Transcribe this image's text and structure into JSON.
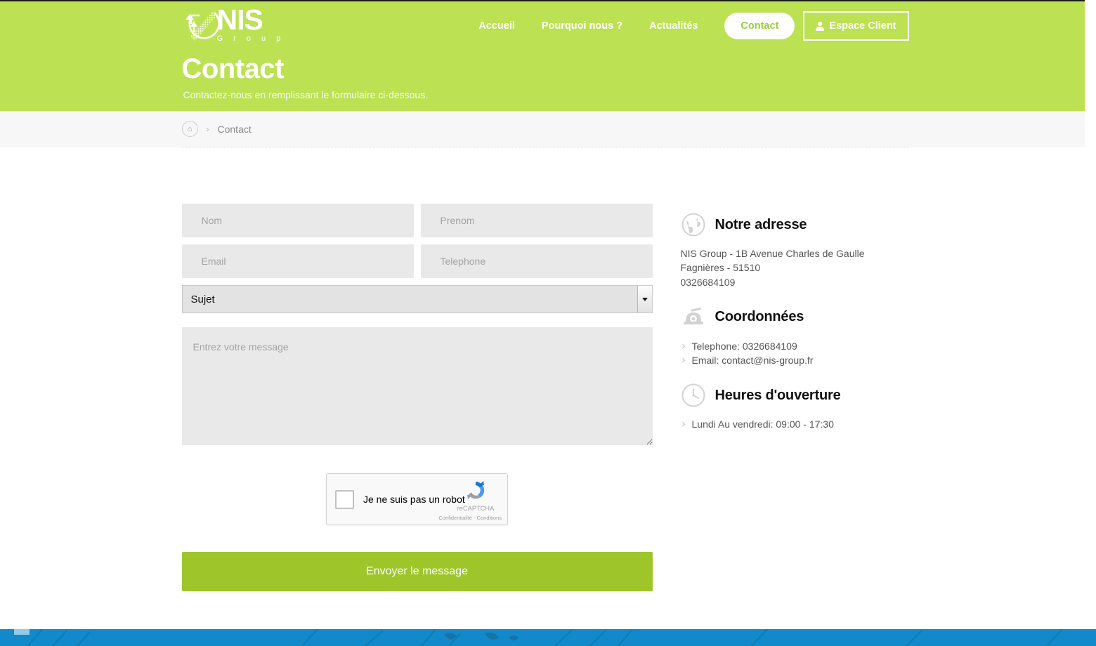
{
  "brand": {
    "name": "NIS",
    "tagline": "G r o u p",
    "logo_icon": "nis-swoosh-logo"
  },
  "nav": {
    "links": [
      {
        "label": "Accueil",
        "icon": null
      },
      {
        "label": "Pourquoi nous ?",
        "icon": null
      },
      {
        "label": "Actualités",
        "icon": null
      }
    ],
    "pill": {
      "label": "Contact"
    },
    "client": {
      "label": "Espace Client",
      "icon": "user-icon"
    }
  },
  "hero": {
    "title": "Contact",
    "subtitle": "Contactez-nous en remplissant le formulaire ci-dessous."
  },
  "breadcrumb": {
    "home_icon": "home-icon",
    "separator": "›",
    "current": "Contact"
  },
  "form": {
    "nom": {
      "placeholder": "Nom",
      "value": ""
    },
    "prenom": {
      "placeholder": "Prenom",
      "value": ""
    },
    "email": {
      "placeholder": "Email",
      "value": ""
    },
    "telephone": {
      "placeholder": "Telephone",
      "value": ""
    },
    "sujet": {
      "selected": "Sujet",
      "options": [
        "Sujet"
      ]
    },
    "message": {
      "placeholder": "Entrez votre message",
      "value": ""
    },
    "submit_label": "Envoyer le message"
  },
  "captcha": {
    "label": "Je ne suis pas un robot",
    "brand": "reCAPTCHA",
    "terms": "Confidentialité - Conditions",
    "logo_icon": "recaptcha-icon"
  },
  "info": {
    "address": {
      "icon": "globe-icon",
      "title": "Notre adresse",
      "line1": "NIS Group - 1B Avenue Charles de Gaulle",
      "line2": "Fagnières - 51510",
      "line3": "0326684109"
    },
    "contact": {
      "icon": "telephone-icon",
      "title": "Coordonnées",
      "items": [
        "Telephone: 0326684109",
        "Email: contact@nis-group.fr"
      ]
    },
    "hours": {
      "icon": "clock-icon",
      "title": "Heures d'ouverture",
      "items": [
        "Lundi Au vendredi: 09:00 - 17:30"
      ]
    }
  },
  "colors": {
    "hero_green": "#bce153",
    "button_green": "#9ec62b",
    "pill_text_green": "#9dcb3b",
    "footer_blue": "#1189ca",
    "field_gray": "#e9e9e9",
    "crumb_bg": "#f7f7f7"
  }
}
